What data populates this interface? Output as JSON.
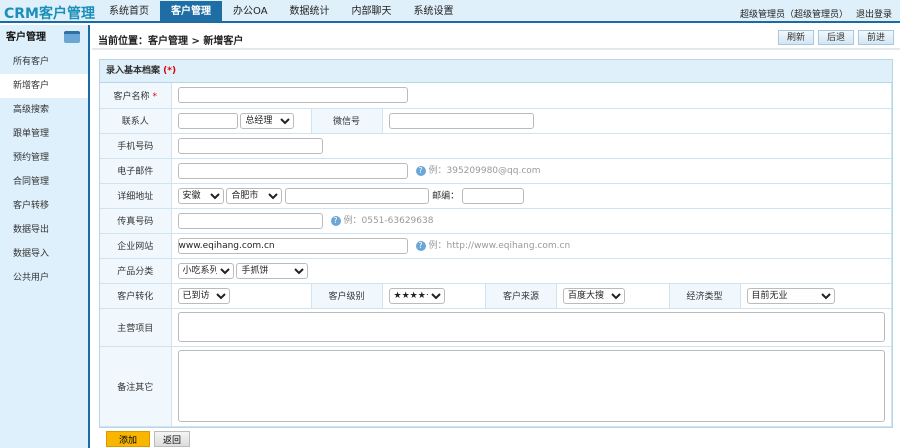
{
  "app": {
    "title": "CRM客户管理"
  },
  "nav": [
    "系统首页",
    "客户管理",
    "办公OA",
    "数据统计",
    "内部聊天",
    "系统设置"
  ],
  "user": {
    "name": "超级管理员（超级管理员）",
    "logout": "退出登录"
  },
  "sidebar": {
    "title": "客户管理",
    "items": [
      "所有客户",
      "新增客户",
      "高级搜索",
      "跟单管理",
      "预约管理",
      "合同管理",
      "客户转移",
      "数据导出",
      "数据导入",
      "公共用户"
    ]
  },
  "breadcrumb": "当前位置：客户管理 > 新增客户",
  "toolbar": {
    "refresh": "刷新",
    "back": "后退",
    "forward": "前进"
  },
  "form": {
    "title": "录入基本档案",
    "required": "(*)",
    "star": "*",
    "labels": {
      "name": "客户名称",
      "contact": "联系人",
      "wechat": "微信号",
      "mobile": "手机号码",
      "email": "电子邮件",
      "address": "详细地址",
      "zip": "邮编：",
      "fax": "传真号码",
      "website": "企业网站",
      "category": "产品分类",
      "conversion": "客户转化",
      "level": "客户级别",
      "source": "客户来源",
      "economy": "经济类型",
      "business": "主营项目",
      "remark": "备注其它"
    },
    "values": {
      "position": "总经理",
      "province": "安徽",
      "city": "合肥市",
      "website": "www.eqihang.com.cn",
      "cat1": "小吃系列",
      "cat2": "手抓饼",
      "conversion": "已到访",
      "level": "★★★★★",
      "source": "百度大搜",
      "economy": "目前无业"
    },
    "hints": {
      "email": "例：395209980@qq.com",
      "fax": "例：0551-63629638",
      "website": "例：http://www.eqihang.com.cn"
    },
    "submit": "添加",
    "return": "返回"
  },
  "colors": {
    "accent": "#1e6ea5",
    "submit": "#f8b600"
  }
}
